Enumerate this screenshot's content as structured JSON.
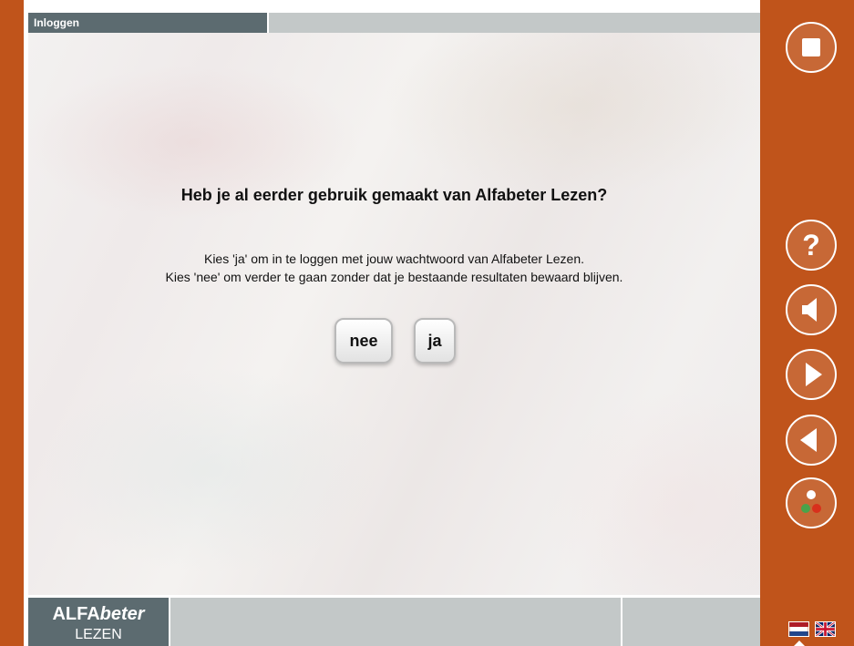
{
  "window": {
    "title": "Inloggen"
  },
  "dialog": {
    "heading": "Heb je al eerder gebruik gemaakt van Alfabeter Lezen?",
    "line1": "Kies 'ja' om in te loggen met jouw wachtwoord van Alfabeter Lezen.",
    "line2": "Kies 'nee' om verder te gaan zonder dat je bestaande resultaten bewaard blijven.",
    "buttons": {
      "no_label": "nee",
      "yes_label": "ja"
    }
  },
  "logo": {
    "prefix": "ALFA",
    "italic": "beter",
    "subtitle": "LEZEN"
  },
  "sidebar": {
    "buttons": [
      "stop-icon",
      "help-icon",
      "speaker-icon",
      "next-icon",
      "previous-icon",
      "people-icon"
    ],
    "languages": [
      "nl-flag-icon",
      "uk-flag-icon"
    ]
  },
  "colors": {
    "frame": "#c0541b",
    "titlebar": "#5c6b70",
    "bar": "#c3c8c8"
  }
}
